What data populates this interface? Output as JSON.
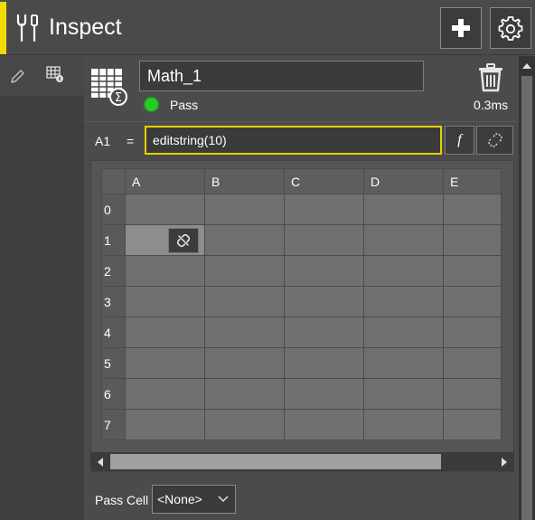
{
  "header": {
    "title": "Inspect",
    "title_icon": "tools-icon",
    "add_icon": "plus-icon",
    "settings_icon": "gear-icon",
    "accent_color": "#f0dc00"
  },
  "rail": {
    "icons": [
      "pencil-icon",
      "grid-info-icon"
    ]
  },
  "tool": {
    "name": "Math_1",
    "status": "Pass",
    "status_color": "#22cc22",
    "time": "0.3ms"
  },
  "formula_bar": {
    "cell_ref": "A1",
    "equals": "=",
    "formula": "editstring(10)",
    "function_label": "f"
  },
  "sheet": {
    "columns": [
      "A",
      "B",
      "C",
      "D",
      "E"
    ],
    "rows": [
      "0",
      "1",
      "2",
      "3",
      "4",
      "5",
      "6",
      "7"
    ],
    "selected_cell": "A1"
  },
  "footer": {
    "pass_cell_label": "Pass Cell",
    "pass_cell_value": "<None>"
  }
}
